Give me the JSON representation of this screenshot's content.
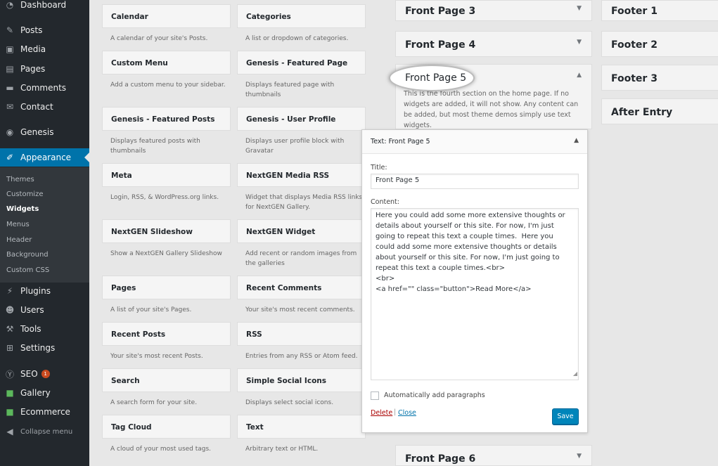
{
  "sidebar": {
    "items": [
      {
        "label": "Dashboard",
        "icon": "dashboard-icon",
        "glyph": "◔"
      },
      {
        "label": "Posts",
        "icon": "pin-icon",
        "glyph": "✎"
      },
      {
        "label": "Media",
        "icon": "media-icon",
        "glyph": "▣"
      },
      {
        "label": "Pages",
        "icon": "pages-icon",
        "glyph": "▤"
      },
      {
        "label": "Comments",
        "icon": "comments-icon",
        "glyph": "▬"
      },
      {
        "label": "Contact",
        "icon": "mail-icon",
        "glyph": "✉"
      },
      {
        "label": "Genesis",
        "icon": "genesis-icon",
        "glyph": "◉"
      },
      {
        "label": "Appearance",
        "icon": "brush-icon",
        "glyph": "✐"
      }
    ],
    "submenu": [
      "Themes",
      "Customize",
      "Widgets",
      "Menus",
      "Header",
      "Background",
      "Custom CSS"
    ],
    "lower": [
      {
        "label": "Plugins",
        "icon": "plug-icon",
        "glyph": "⚡"
      },
      {
        "label": "Users",
        "icon": "user-icon",
        "glyph": "☻"
      },
      {
        "label": "Tools",
        "icon": "wrench-icon",
        "glyph": "⚒"
      },
      {
        "label": "Settings",
        "icon": "settings-icon",
        "glyph": "⊞"
      },
      {
        "label": "SEO",
        "icon": "seo-icon",
        "glyph": "Ⓨ"
      },
      {
        "label": "Gallery",
        "icon": "gallery-icon",
        "glyph": "■"
      },
      {
        "label": "Ecommerce",
        "icon": "ecommerce-icon",
        "glyph": "■"
      }
    ],
    "seo_badge": "1",
    "collapse": "Collapse menu",
    "colors": {
      "bg": "#23282d",
      "active": "#0073aa",
      "submenu_bg": "#32373c"
    }
  },
  "widgets": [
    {
      "title": "Calendar",
      "desc": "A calendar of your site's Posts."
    },
    {
      "title": "Categories",
      "desc": "A list or dropdown of categories."
    },
    {
      "title": "Custom Menu",
      "desc": "Add a custom menu to your sidebar."
    },
    {
      "title": "Genesis - Featured Page",
      "desc": "Displays featured page with thumbnails"
    },
    {
      "title": "Genesis - Featured Posts",
      "desc": "Displays featured posts with thumbnails"
    },
    {
      "title": "Genesis - User Profile",
      "desc": "Displays user profile block with Gravatar"
    },
    {
      "title": "Meta",
      "desc": "Login, RSS, & WordPress.org links."
    },
    {
      "title": "NextGEN Media RSS",
      "desc": "Widget that displays Media RSS links for NextGEN Gallery."
    },
    {
      "title": "NextGEN Slideshow",
      "desc": "Show a NextGEN Gallery Slideshow"
    },
    {
      "title": "NextGEN Widget",
      "desc": "Add recent or random images from the galleries"
    },
    {
      "title": "Pages",
      "desc": "A list of your site's Pages."
    },
    {
      "title": "Recent Comments",
      "desc": "Your site's most recent comments."
    },
    {
      "title": "Recent Posts",
      "desc": "Your site's most recent Posts."
    },
    {
      "title": "RSS",
      "desc": "Entries from any RSS or Atom feed."
    },
    {
      "title": "Search",
      "desc": "A search form for your site."
    },
    {
      "title": "Simple Social Icons",
      "desc": "Displays select social icons."
    },
    {
      "title": "Tag Cloud",
      "desc": "A cloud of your most used tags."
    },
    {
      "title": "Text",
      "desc": "Arbitrary text or HTML."
    }
  ],
  "areas_mid": {
    "front3": "Front Page 3",
    "front4": "Front Page 4",
    "front5": "Front Page 5",
    "front5_desc": "This is the fourth section on the home page. If no widgets are added, it will not show. Any content can be added, but most theme demos simply use text widgets.",
    "front6": "Front Page 6"
  },
  "areas_right": [
    "Footer 1",
    "Footer 2",
    "Footer 3",
    "After Entry"
  ],
  "panel": {
    "type_label": "Text:",
    "name": "Front Page 5",
    "title_label": "Title:",
    "title_value": "Front Page 5",
    "content_label": "Content:",
    "content_value": "Here you could add some more extensive thoughts or details about yourself or this site. For now, I'm just going to repeat this text a couple times.  Here you could add some more extensive thoughts or details about yourself or this site. For now, I'm just going to repeat this text a couple times.<br>\n<br>\n<a href=\"\" class=\"button\">Read More</a>",
    "auto_paragraphs": "Automatically add paragraphs",
    "delete": "Delete",
    "separator": "|",
    "close": "Close",
    "save": "Save"
  }
}
